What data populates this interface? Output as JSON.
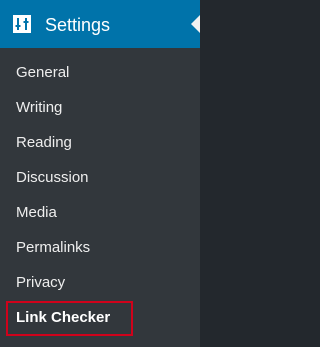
{
  "menu": {
    "header_label": "Settings",
    "header_icon": "settings-sliders-icon",
    "colors": {
      "header_bg": "#0073aa",
      "submenu_bg": "#32373c",
      "highlight_border": "#d0021b"
    },
    "items": [
      {
        "label": "General"
      },
      {
        "label": "Writing"
      },
      {
        "label": "Reading"
      },
      {
        "label": "Discussion"
      },
      {
        "label": "Media"
      },
      {
        "label": "Permalinks"
      },
      {
        "label": "Privacy"
      },
      {
        "label": "Link Checker"
      }
    ]
  }
}
